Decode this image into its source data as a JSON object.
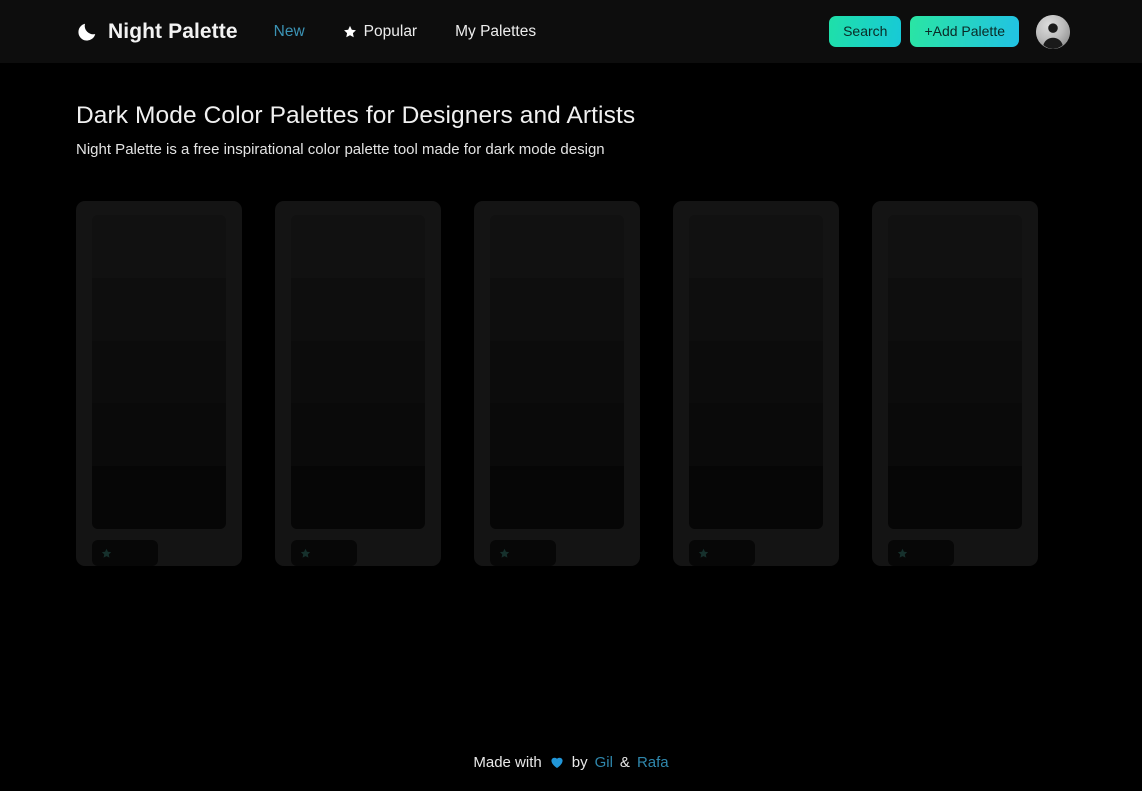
{
  "header": {
    "brand": {
      "icon": "moon-icon",
      "name": "Night Palette"
    },
    "nav": [
      {
        "label": "New",
        "icon": null,
        "active": true
      },
      {
        "label": "Popular",
        "icon": "star-icon",
        "active": false
      },
      {
        "label": "My Palettes",
        "icon": null,
        "active": false
      }
    ],
    "actions": {
      "search_label": "Search",
      "add_palette_label": "+Add Palette",
      "avatar_icon": "user-avatar-icon"
    }
  },
  "main": {
    "title": "Dark Mode Color Palettes for Designers and Artists",
    "subtitle": "Night Palette is a free inspirational color palette tool made for dark mode design",
    "cards": [
      {
        "swatches": [
          "#111111",
          "#0e0e0e",
          "#0c0c0c",
          "#0a0a0a",
          "#060606"
        ],
        "fav_icon": "star-icon"
      },
      {
        "swatches": [
          "#111111",
          "#0e0e0e",
          "#0c0c0c",
          "#0a0a0a",
          "#060606"
        ],
        "fav_icon": "star-icon"
      },
      {
        "swatches": [
          "#111111",
          "#0e0e0e",
          "#0c0c0c",
          "#0a0a0a",
          "#060606"
        ],
        "fav_icon": "star-icon"
      },
      {
        "swatches": [
          "#111111",
          "#0e0e0e",
          "#0c0c0c",
          "#0a0a0a",
          "#060606"
        ],
        "fav_icon": "star-icon"
      },
      {
        "swatches": [
          "#111111",
          "#0e0e0e",
          "#0c0c0c",
          "#0a0a0a",
          "#060606"
        ],
        "fav_icon": "star-icon"
      }
    ]
  },
  "footer": {
    "made_with": "Made with",
    "heart_icon": "heart-icon",
    "by": "by",
    "author_one": "Gil",
    "ampersand": "&",
    "author_two": "Rafa"
  },
  "colors": {
    "page_background": "#000000",
    "header_background": "#0d0d0d",
    "card_background": "#141414",
    "accent_green": "#2ae5a3",
    "accent_cyan": "#21c2e4",
    "link_blue": "#2f87ac",
    "nav_active": "#3b93b5",
    "heart_blue": "#2196d8",
    "text_primary": "#f0f0f0"
  }
}
